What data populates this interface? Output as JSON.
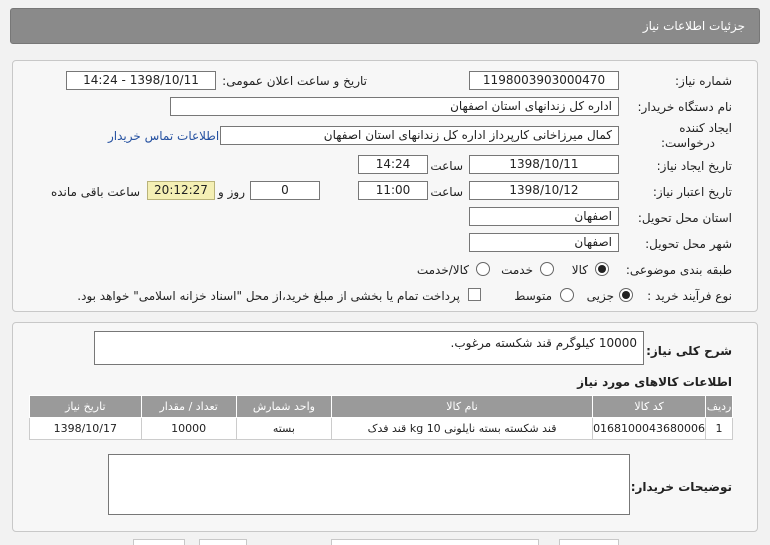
{
  "header": {
    "title": "جزئیات اطلاعات نیاز"
  },
  "form": {
    "need_number_label": "شماره نیاز:",
    "need_number": "1198003903000470",
    "announce_label": "تاریخ و ساعت اعلان عمومی:",
    "announce_value": "1398/10/11 - 14:24",
    "buyer_org_label": "نام دستگاه خریدار:",
    "buyer_org": "اداره کل زندانهای استان اصفهان",
    "creator_label_1": "ایجاد کننده",
    "creator_label_2": "درخواست:",
    "creator": "کمال میرزاخانی کارپرداز اداره کل زندانهای استان اصفهان",
    "contact_link": "اطلاعات تماس خریدار",
    "create_date_label": "تاریخ ایجاد نیاز:",
    "create_date": "1398/10/11",
    "time_label": "ساعت",
    "create_time": "14:24",
    "valid_date_label": "تاریخ اعتبار نیاز:",
    "valid_date": "1398/10/12",
    "valid_time": "11:00",
    "days_value": "0",
    "days_label": "روز و",
    "remaining_time": "20:12:27",
    "remaining_label": "ساعت باقی مانده",
    "province_label": "استان محل تحویل:",
    "province": "اصفهان",
    "city_label": "شهر محل تحویل:",
    "city": "اصفهان",
    "category_label": "طبقه بندی موضوعی:",
    "category_options": [
      "کالا",
      "خدمت",
      "کالا/خدمت"
    ],
    "process_label": "نوع فرآیند خرید :",
    "process_options": [
      "جزیی",
      "متوسط"
    ],
    "payment_note": "پرداخت تمام یا بخشی از مبلغ خرید،از محل \"اسناد خزانه اسلامی\" خواهد بود."
  },
  "summary": {
    "label": "شرح کلی نیاز:",
    "text": "10000 کیلوگرم قند شکسته مرغوب."
  },
  "goods": {
    "title": "اطلاعات کالاهای مورد نیاز",
    "columns": [
      "ردیف",
      "کد کالا",
      "نام کالا",
      "واحد شمارش",
      "تعداد / مقدار",
      "تاریخ نیاز"
    ],
    "rows": [
      [
        "1",
        "0168100043680006",
        "قند شکسته بسته نایلونی 10 kg قند فدک",
        "بسته",
        "10000",
        "1398/10/17"
      ]
    ]
  },
  "buyer_notes": {
    "label": "توضیحات خریدار:",
    "text": ""
  }
}
